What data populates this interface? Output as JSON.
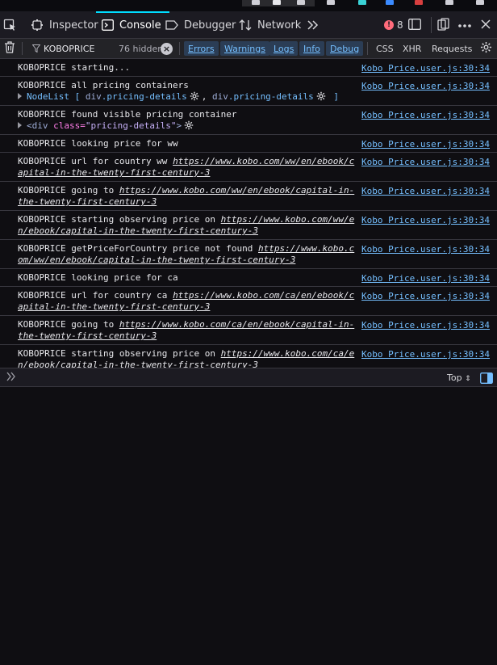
{
  "toolbar": {
    "tabs": [
      {
        "label": "Inspector",
        "icon": "inspector-icon"
      },
      {
        "label": "Console",
        "icon": "console-icon"
      },
      {
        "label": "Debugger",
        "icon": "debugger-icon"
      },
      {
        "label": "Network",
        "icon": "network-icon"
      }
    ],
    "error_count": "8"
  },
  "filter": {
    "text": "KOBOPRICE",
    "hidden_count": "76 hidden",
    "levels": [
      "Errors",
      "Warnings",
      "Logs",
      "Info",
      "Debug"
    ],
    "types": [
      "CSS",
      "XHR",
      "Requests"
    ]
  },
  "log": {
    "source": "Kobo Price.user.js:30:34",
    "rows": [
      {
        "text": "KOBOPRICE starting..."
      },
      {
        "text": "KOBOPRICE all pricing containers",
        "sub": {
          "prefix": "NodeList [",
          "item1_tag": "div",
          "item1_class": ".pricing-details",
          "comma": ",",
          "item2_tag": "div",
          "item2_class": ".pricing-details",
          "suffix": "]"
        }
      },
      {
        "text": "KOBOPRICE found visible pricing container",
        "sub": {
          "open": "<div",
          "attr": "class=",
          "value": "\"pricing-details\"",
          "close": ">"
        }
      },
      {
        "text": "KOBOPRICE looking price for ww"
      },
      {
        "text": "KOBOPRICE url for country ww",
        "url": "https://www.kobo.com/ww/en/ebook/capital-in-the-twenty-first-century-3"
      },
      {
        "text": "KOBOPRICE going to",
        "url": "https://www.kobo.com/ww/en/ebook/capital-in-the-twenty-first-century-3"
      },
      {
        "text": "KOBOPRICE starting observing price on",
        "url": "https://www.kobo.com/ww/en/ebook/capital-in-the-twenty-first-century-3"
      },
      {
        "text": "KOBOPRICE getPriceForCountry price not found",
        "url": "https://www.kobo.com/ww/en/ebook/capital-in-the-twenty-first-century-3"
      },
      {
        "text": "KOBOPRICE looking price for ca"
      },
      {
        "text": "KOBOPRICE url for country ca",
        "url": "https://www.kobo.com/ca/en/ebook/capital-in-the-twenty-first-century-3"
      },
      {
        "text": "KOBOPRICE going to",
        "url": "https://www.kobo.com/ca/en/ebook/capital-in-the-twenty-first-century-3"
      },
      {
        "text": "KOBOPRICE starting observing price on",
        "url": "https://www.kobo.com/ca/en/ebook/capital-in-the-twenty-first-century-3"
      }
    ]
  },
  "input": {
    "context": "Top"
  },
  "colors": {
    "accent": "#00ddff",
    "link": "#75bfff",
    "error": "#ff6b7b"
  }
}
